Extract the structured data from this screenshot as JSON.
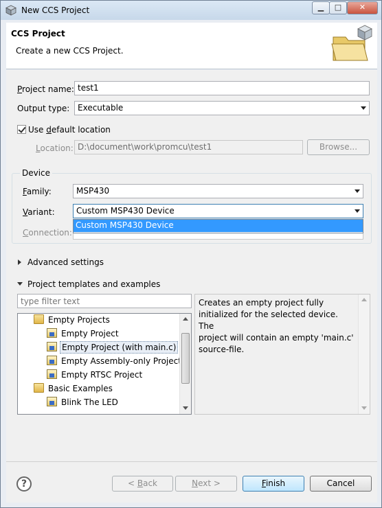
{
  "window": {
    "title": "New CCS Project",
    "controls": {
      "minimize": "▁",
      "maximize": "□",
      "close": "✕"
    }
  },
  "header": {
    "title": "CCS Project",
    "subtitle": "Create a new CCS Project."
  },
  "project_name": {
    "label_u": "P",
    "label_rest": "roject name:",
    "value": "test1"
  },
  "output_type": {
    "label": "Output type:",
    "value": "Executable"
  },
  "use_default_location": {
    "label_pre": "Use ",
    "label_u": "d",
    "label_rest": "efault location",
    "checked": true
  },
  "location": {
    "label_u": "L",
    "label_rest": "ocation:",
    "value": "D:\\document\\work\\promcu\\test1",
    "browse_label": "Browse..."
  },
  "device": {
    "group_title": "Device",
    "family": {
      "label_u": "F",
      "label_rest": "amily:",
      "value": "MSP430"
    },
    "variant": {
      "label_u": "V",
      "label_rest": "ariant:",
      "value": "Custom MSP430 Device",
      "dropdown_option": "Custom MSP430 Device"
    },
    "connection": {
      "label_u": "C",
      "label_rest": "onnection:"
    }
  },
  "advanced_settings": {
    "label": "Advanced settings"
  },
  "templates": {
    "label": "Project templates and examples",
    "filter_placeholder": "type filter text",
    "tree": [
      {
        "label": "Empty Projects",
        "kind": "folder",
        "level": 0
      },
      {
        "label": "Empty Project",
        "kind": "project",
        "level": 1
      },
      {
        "label": "Empty Project (with main.c)",
        "kind": "project",
        "level": 1,
        "selected": true
      },
      {
        "label": "Empty Assembly-only Project",
        "kind": "project",
        "level": 1
      },
      {
        "label": "Empty RTSC Project",
        "kind": "project",
        "level": 1
      },
      {
        "label": "Basic Examples",
        "kind": "folder",
        "level": 0
      },
      {
        "label": "Blink The LED",
        "kind": "project",
        "level": 1
      }
    ],
    "description": "Creates an empty project fully\ninitialized for the selected device. The\nproject will contain an empty 'main.c'\nsource-file."
  },
  "footer": {
    "help_label": "?",
    "back_pre": "< ",
    "back_u": "B",
    "back_rest": "ack",
    "next_u": "N",
    "next_rest": "ext >",
    "finish_u": "F",
    "finish_rest": "inish",
    "cancel_label": "Cancel"
  }
}
